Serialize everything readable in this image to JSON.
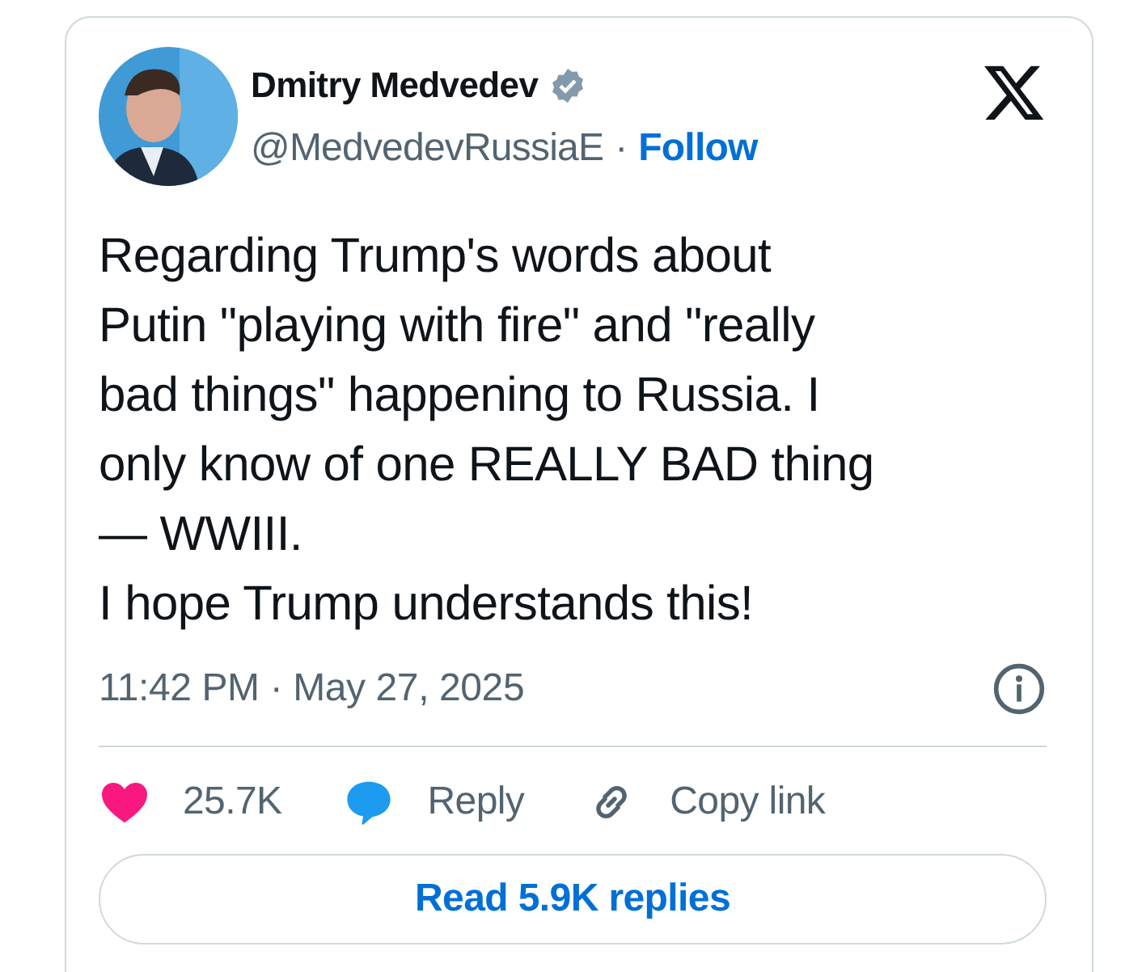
{
  "author": {
    "name": "Dmitry Medvedev",
    "verified": true,
    "handle": "@MedvedevRussiaE",
    "separator": "·",
    "follow": "Follow"
  },
  "body": "Regarding Trump's words about\nPutin \"playing with fire\" and \"really\nbad things\" happening to Russia. I\nonly know of one REALLY BAD thing\n— WWIII.\nI hope Trump understands this!",
  "timestamp": "11:42 PM · May 27, 2025",
  "actions": [
    {
      "kind": "like",
      "label": "25.7K"
    },
    {
      "kind": "reply",
      "label": "Reply"
    },
    {
      "kind": "copy",
      "label": "Copy link"
    }
  ],
  "read_button": "Read 5.9K replies"
}
